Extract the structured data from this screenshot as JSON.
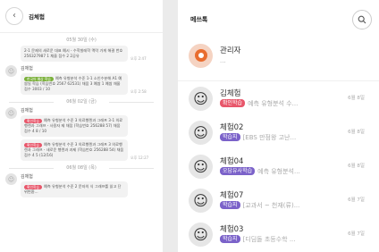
{
  "chat": {
    "title": "김체험",
    "back_icon": "chevron-left-icon",
    "date1": "05월 30일 (수)",
    "msg0": {
      "text": "2-1 문제의 새로운 대표 예시 - 수학발레학 맥락 가게 해결 번호 256327987 1 채울 점수 2 2공유",
      "time": "오후 2:47"
    },
    "msg1": {
      "sender": "김체험",
      "badge": "한국어 예상 학습",
      "text": "예측 유형분석 수준 1-1 소인수분해 A1 예쌈일 학습 (학습번호 2567 62531) 채움 3 예쌈 1 예쌈 채울 점수 3003 / 10",
      "time": "오후 2:58"
    },
    "date2": "06월 02일 (금)",
    "msg2": {
      "sender": "김체험",
      "badge": "확인학습",
      "text": "예측 유형분석 수준 3 의료행렌과 그래프 3-1 의료행렌과 그래프 - 사용자 제 채점 (학습번호 256288 57) 채움 점수 4 8 / 10",
      "time": ""
    },
    "msg3": {
      "badge": "확인학습",
      "text": "예측 유형분석 수준 3 의료행렌과 그래프 3 의료행렌과 그래프 - 새로운 행렌과 과제 (학습번호 256288 54) 채움 점수 4 5 (12/16)",
      "time": "오후 12:27"
    },
    "date3": "06월 08일 (목)",
    "msg4": {
      "sender": "김체험",
      "badge": "확인학습",
      "text": "예측 유형분석 수준 2 문자의 식 그래프를 읽고 단위변환..."
    }
  },
  "list": {
    "title": "메쓰톡",
    "search_icon": "search-icon",
    "items": [
      {
        "name": "관리자",
        "preview": "...",
        "date": ""
      },
      {
        "name": "김체험",
        "badge": "확인학습",
        "badge_color": "#f28a3a",
        "preview": "예측 유형분석 수...",
        "date": "6월 8일"
      },
      {
        "name": "체험02",
        "badge": "학습지",
        "badge_color": "#7b62c9",
        "preview": "[EBS 만점왕 고난...",
        "date": "6월 8일"
      },
      {
        "name": "체험04",
        "badge": "오답유사학습",
        "badge_color": "#7b62c9",
        "preview": "예측 유형분석...",
        "date": "6월 8일"
      },
      {
        "name": "체험07",
        "badge": "학습지",
        "badge_color": "#7b62c9",
        "preview": "[교과서 ~ 천재(류)...",
        "date": "6월 7일"
      },
      {
        "name": "체험03",
        "badge": "학습지",
        "badge_color": "#7b62c9",
        "preview": "[디딤돌 초등수학 ...",
        "date": "6월 7일"
      }
    ]
  }
}
